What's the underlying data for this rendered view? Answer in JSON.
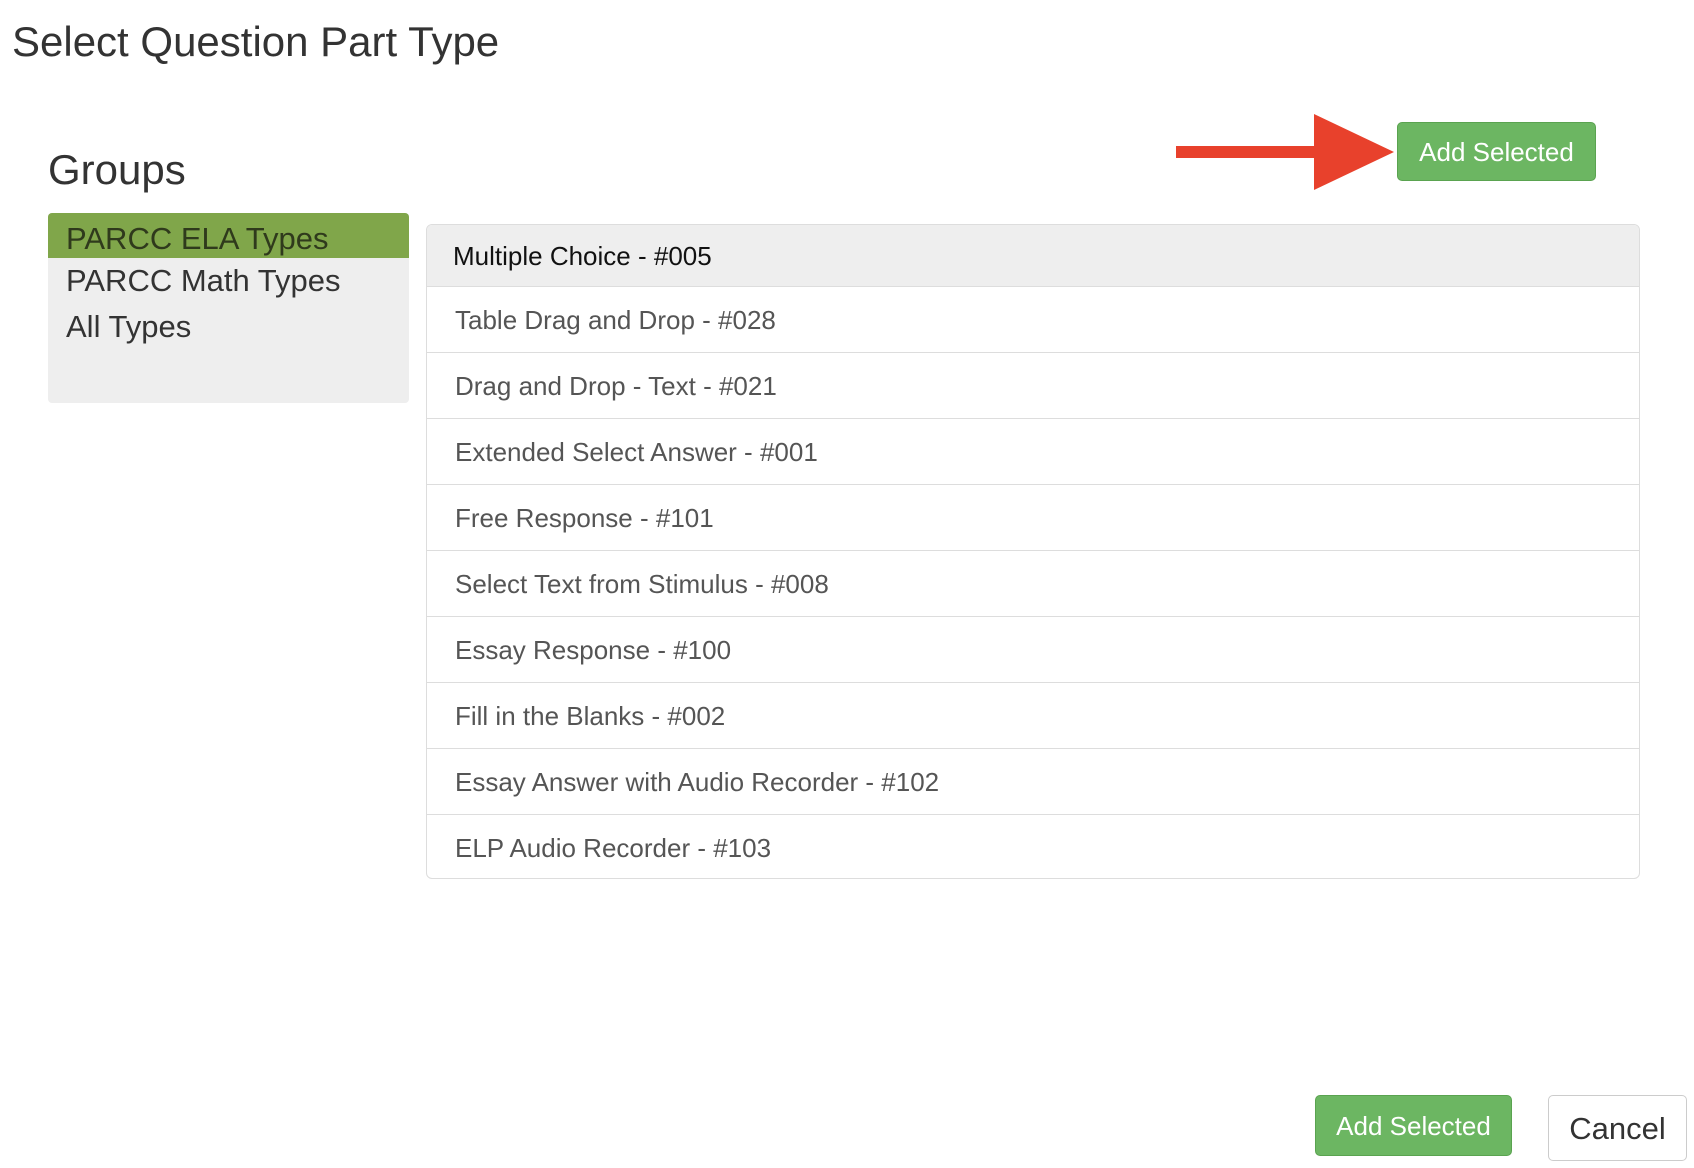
{
  "page": {
    "title": "Select Question Part Type"
  },
  "groups": {
    "heading": "Groups",
    "items": [
      {
        "label": "PARCC ELA Types",
        "active": true
      },
      {
        "label": "PARCC Math Types",
        "active": false
      },
      {
        "label": "All Types",
        "active": false
      }
    ]
  },
  "types": {
    "items": [
      {
        "label": "Multiple Choice - #005",
        "selected": true
      },
      {
        "label": "Table Drag and Drop - #028",
        "selected": false
      },
      {
        "label": "Drag and Drop - Text - #021",
        "selected": false
      },
      {
        "label": "Extended Select Answer - #001",
        "selected": false
      },
      {
        "label": "Free Response - #101",
        "selected": false
      },
      {
        "label": "Select Text from Stimulus - #008",
        "selected": false
      },
      {
        "label": "Essay Response - #100",
        "selected": false
      },
      {
        "label": "Fill in the Blanks - #002",
        "selected": false
      },
      {
        "label": "Essay Answer with Audio Recorder - #102",
        "selected": false
      },
      {
        "label": "ELP Audio Recorder - #103",
        "selected": false
      }
    ]
  },
  "actions": {
    "top_add_label": "Add Selected",
    "bottom_add_label": "Add Selected",
    "cancel_label": "Cancel"
  },
  "annotation": {
    "icon": "arrow-right-icon",
    "color": "#e8412c"
  },
  "colors": {
    "active_group": "#80a64a",
    "success_button": "#6cb662",
    "selected_row": "#eeeeee"
  }
}
